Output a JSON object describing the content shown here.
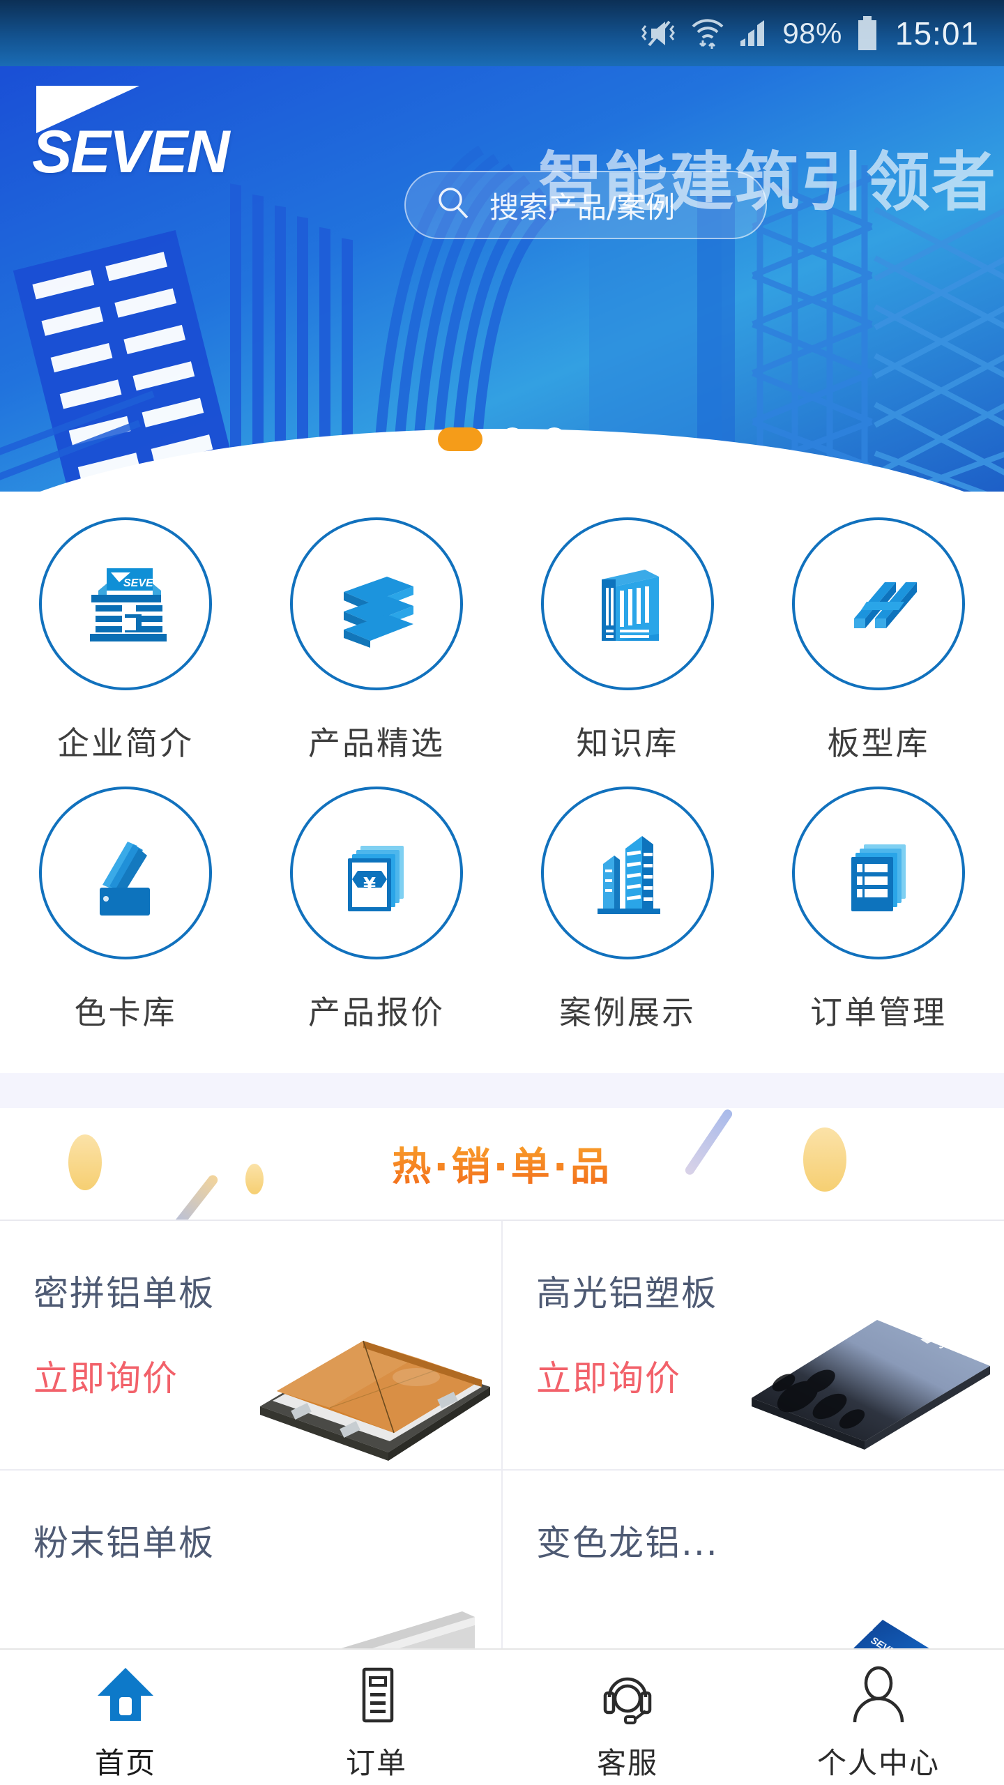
{
  "statusbar": {
    "mute_icon": "mute-vibrate-icon",
    "wifi_icon": "wifi-icon",
    "signal_icon": "cellular-signal-icon",
    "battery_percent": "98%",
    "battery_icon": "battery-icon",
    "time": "15:01"
  },
  "banner": {
    "brand": "SEVEN",
    "brand_mark": "seven-swoosh-logo",
    "slogan": "智能建筑引领者",
    "search_placeholder": "搜索产品/案例",
    "search_icon": "search-icon",
    "carousel": {
      "count": 3,
      "active_index": 0,
      "active_color": "#f59c19",
      "inactive_color": "#ffffff"
    }
  },
  "grid": {
    "items": [
      {
        "label": "企业简介",
        "icon": "company-building-icon"
      },
      {
        "label": "产品精选",
        "icon": "stacked-panels-icon"
      },
      {
        "label": "知识库",
        "icon": "book-shelf-icon"
      },
      {
        "label": "板型库",
        "icon": "profile-beams-icon"
      },
      {
        "label": "色卡库",
        "icon": "color-swatch-fan-icon"
      },
      {
        "label": "产品报价",
        "icon": "banknotes-yuan-icon"
      },
      {
        "label": "案例展示",
        "icon": "skyscrapers-icon"
      },
      {
        "label": "订单管理",
        "icon": "document-stack-icon"
      }
    ],
    "circle_border_color": "#1171bd",
    "icon_color": "#1787d4"
  },
  "hot_section": {
    "title": "热·销·单·品",
    "gradient_from": "#f9a52c",
    "gradient_to": "#f26a1b"
  },
  "products": [
    {
      "title": "密拼铝单板",
      "cta": "立即询价",
      "image": "tile-panel-render"
    },
    {
      "title": "高光铝塑板",
      "cta": "立即询价",
      "image": "glossy-composite-panel-render"
    },
    {
      "title": "粉末铝单板",
      "cta": "",
      "image": "powder-coated-panel-render"
    },
    {
      "title": "变色龙铝...",
      "cta": "",
      "image": "chameleon-panel-render"
    }
  ],
  "tabbar": {
    "items": [
      {
        "label": "首页",
        "icon": "home-icon",
        "active": true
      },
      {
        "label": "订单",
        "icon": "order-list-icon",
        "active": false
      },
      {
        "label": "客服",
        "icon": "headset-icon",
        "active": false
      },
      {
        "label": "个人中心",
        "icon": "user-icon",
        "active": false
      }
    ],
    "active_color": "#0d79c9",
    "inactive_color": "#2b2b2b"
  }
}
